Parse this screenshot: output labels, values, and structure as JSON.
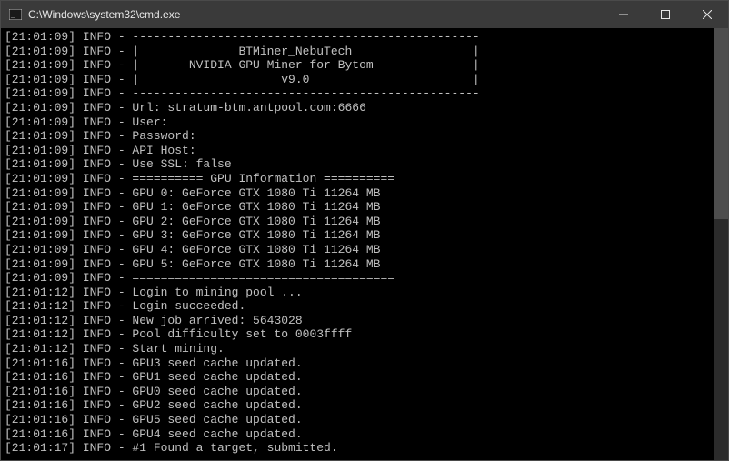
{
  "titlebar": {
    "title": "C:\\Windows\\system32\\cmd.exe"
  },
  "lines": [
    {
      "ts": "[21:01:09]",
      "level": "INFO",
      "msg": "-------------------------------------------------"
    },
    {
      "ts": "[21:01:09]",
      "level": "INFO",
      "msg": "|              BTMiner_NebuTech                 |"
    },
    {
      "ts": "[21:01:09]",
      "level": "INFO",
      "msg": "|       NVIDIA GPU Miner for Bytom              |"
    },
    {
      "ts": "[21:01:09]",
      "level": "INFO",
      "msg": "|                    v9.0                       |"
    },
    {
      "ts": "[21:01:09]",
      "level": "INFO",
      "msg": "-------------------------------------------------"
    },
    {
      "ts": "[21:01:09]",
      "level": "INFO",
      "msg": "Url: stratum-btm.antpool.com:6666"
    },
    {
      "ts": "[21:01:09]",
      "level": "INFO",
      "msg": "User:"
    },
    {
      "ts": "[21:01:09]",
      "level": "INFO",
      "msg": "Password:"
    },
    {
      "ts": "[21:01:09]",
      "level": "INFO",
      "msg": "API Host:"
    },
    {
      "ts": "[21:01:09]",
      "level": "INFO",
      "msg": "Use SSL: false"
    },
    {
      "ts": "[21:01:09]",
      "level": "INFO",
      "msg": "========== GPU Information =========="
    },
    {
      "ts": "[21:01:09]",
      "level": "INFO",
      "msg": "GPU 0: GeForce GTX 1080 Ti 11264 MB"
    },
    {
      "ts": "[21:01:09]",
      "level": "INFO",
      "msg": "GPU 1: GeForce GTX 1080 Ti 11264 MB"
    },
    {
      "ts": "[21:01:09]",
      "level": "INFO",
      "msg": "GPU 2: GeForce GTX 1080 Ti 11264 MB"
    },
    {
      "ts": "[21:01:09]",
      "level": "INFO",
      "msg": "GPU 3: GeForce GTX 1080 Ti 11264 MB"
    },
    {
      "ts": "[21:01:09]",
      "level": "INFO",
      "msg": "GPU 4: GeForce GTX 1080 Ti 11264 MB"
    },
    {
      "ts": "[21:01:09]",
      "level": "INFO",
      "msg": "GPU 5: GeForce GTX 1080 Ti 11264 MB"
    },
    {
      "ts": "[21:01:09]",
      "level": "INFO",
      "msg": "====================================="
    },
    {
      "ts": "[21:01:12]",
      "level": "INFO",
      "msg": "Login to mining pool ..."
    },
    {
      "ts": "[21:01:12]",
      "level": "INFO",
      "msg": "Login succeeded."
    },
    {
      "ts": "[21:01:12]",
      "level": "INFO",
      "msg": "New job arrived: 5643028"
    },
    {
      "ts": "[21:01:12]",
      "level": "INFO",
      "msg": "Pool difficulty set to 0003ffff"
    },
    {
      "ts": "[21:01:12]",
      "level": "INFO",
      "msg": "Start mining."
    },
    {
      "ts": "[21:01:16]",
      "level": "INFO",
      "msg": "GPU3 seed cache updated."
    },
    {
      "ts": "[21:01:16]",
      "level": "INFO",
      "msg": "GPU1 seed cache updated."
    },
    {
      "ts": "[21:01:16]",
      "level": "INFO",
      "msg": "GPU0 seed cache updated."
    },
    {
      "ts": "[21:01:16]",
      "level": "INFO",
      "msg": "GPU2 seed cache updated."
    },
    {
      "ts": "[21:01:16]",
      "level": "INFO",
      "msg": "GPU5 seed cache updated."
    },
    {
      "ts": "[21:01:16]",
      "level": "INFO",
      "msg": "GPU4 seed cache updated."
    },
    {
      "ts": "[21:01:17]",
      "level": "INFO",
      "msg": "#1 Found a target, submitted."
    }
  ]
}
